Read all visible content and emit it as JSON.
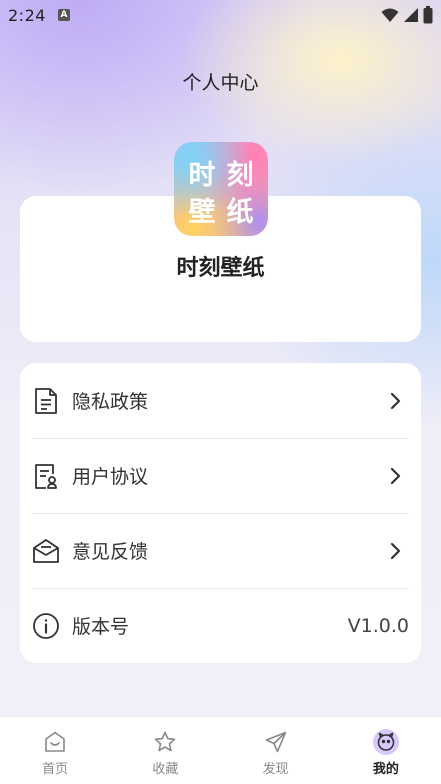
{
  "status_bar": {
    "time": "2:24",
    "notif_icon": "a-icon"
  },
  "header": {
    "title": "个人中心"
  },
  "profile": {
    "app_name": "时刻壁纸",
    "logo_chars": [
      "时",
      "刻",
      "壁",
      "纸"
    ]
  },
  "menu": {
    "items": [
      {
        "label": "隐私政策",
        "icon": "document-icon"
      },
      {
        "label": "用户协议",
        "icon": "agreement-icon"
      },
      {
        "label": "意见反馈",
        "icon": "mail-icon"
      },
      {
        "label": "版本号",
        "icon": "info-icon",
        "value": "V1.0.0"
      }
    ]
  },
  "tabs": [
    {
      "label": "首页",
      "icon": "home-icon"
    },
    {
      "label": "收藏",
      "icon": "star-icon"
    },
    {
      "label": "发现",
      "icon": "send-icon"
    },
    {
      "label": "我的",
      "icon": "profile-icon",
      "active": true
    }
  ],
  "colors": {
    "accent": "#d7c9fb",
    "card": "#ffffff",
    "text": "#222222"
  }
}
